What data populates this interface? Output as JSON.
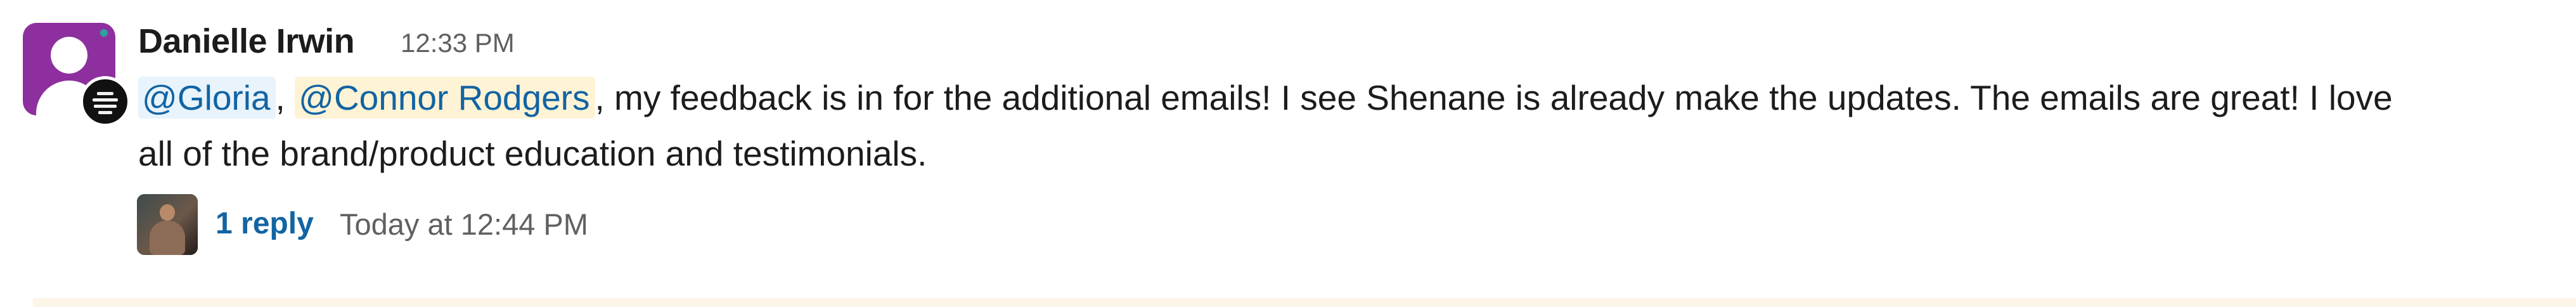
{
  "message": {
    "author": "Danielle Irwin",
    "time": "12:33 PM",
    "text": {
      "mention_1": "@Gloria",
      "separator_1": ", ",
      "mention_2": "@Connor Rodgers",
      "line_1_rest": ", my feedback is in for the additional emails! I see Shenane is already make the updates. The emails are great! I love",
      "line_2": "all of the brand/product education and testimonials."
    }
  },
  "thread": {
    "reply_count": "1 reply",
    "last_reply": "Today at 12:44 PM"
  },
  "colors": {
    "avatar_bg": "#8e2f9f",
    "mention_text": "#1264a3",
    "mention_bg": "#e8f3fb",
    "mention_highlight_bg": "#fff3d6",
    "link": "#1264a3",
    "muted": "#616061",
    "bottom_bar": "#fcf5e8"
  },
  "icons": {
    "author_avatar": "default-user-avatar",
    "status_badge": "status-badge-icon",
    "reply_avatar": "reply-user-avatar"
  }
}
